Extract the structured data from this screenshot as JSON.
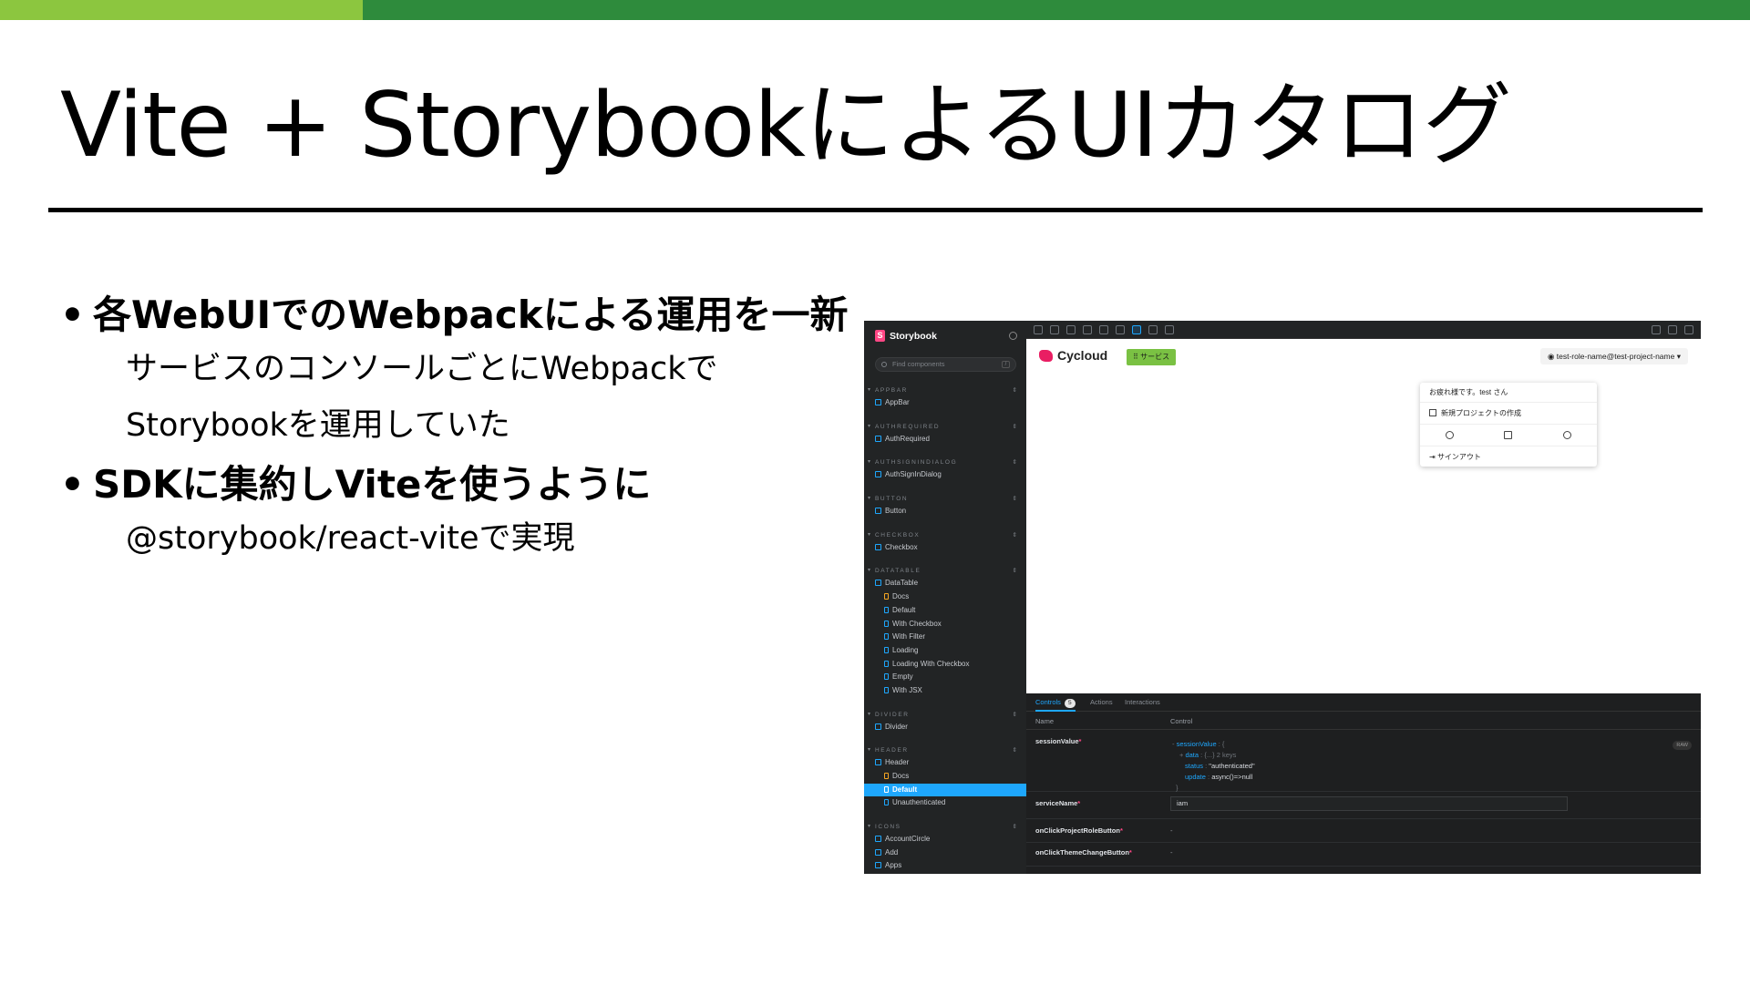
{
  "slide": {
    "title": "Vite + StorybookによるUIカタログ",
    "bullets": [
      {
        "text": "各WebUIでのWebpackによる運用を一新",
        "sub": [
          "サービスのコンソールごとにWebpackで",
          "Storybookを運用していた"
        ]
      },
      {
        "text": "SDKに集約しViteを使うように",
        "sub": [
          "@storybook/react-viteで実現"
        ]
      }
    ],
    "bullet_glyph": "•"
  },
  "colors": {
    "accent_light": "#8cc63f",
    "accent_dark": "#2e8b3c",
    "storybook_blue": "#1ea7fd",
    "storybook_pink": "#ff4785"
  },
  "storybook": {
    "brand": "Storybook",
    "search_placeholder": "Find components",
    "search_shortcut": "/",
    "groups": [
      {
        "label": "APPBAR",
        "items": [
          {
            "label": "AppBar",
            "kind": "component"
          }
        ]
      },
      {
        "label": "AUTHREQUIRED",
        "items": [
          {
            "label": "AuthRequired",
            "kind": "component"
          }
        ]
      },
      {
        "label": "AUTHSIGNINDIALOG",
        "items": [
          {
            "label": "AuthSignInDialog",
            "kind": "component"
          }
        ]
      },
      {
        "label": "BUTTON",
        "items": [
          {
            "label": "Button",
            "kind": "component"
          }
        ]
      },
      {
        "label": "CHECKBOX",
        "items": [
          {
            "label": "Checkbox",
            "kind": "component"
          }
        ]
      },
      {
        "label": "DATATABLE",
        "items": [
          {
            "label": "DataTable",
            "kind": "component"
          },
          {
            "label": "Docs",
            "kind": "doc"
          },
          {
            "label": "Default",
            "kind": "story"
          },
          {
            "label": "With Checkbox",
            "kind": "story"
          },
          {
            "label": "With Filter",
            "kind": "story"
          },
          {
            "label": "Loading",
            "kind": "story"
          },
          {
            "label": "Loading With Checkbox",
            "kind": "story"
          },
          {
            "label": "Empty",
            "kind": "story"
          },
          {
            "label": "With JSX",
            "kind": "story"
          }
        ]
      },
      {
        "label": "DIVIDER",
        "items": [
          {
            "label": "Divider",
            "kind": "component"
          }
        ]
      },
      {
        "label": "HEADER",
        "items": [
          {
            "label": "Header",
            "kind": "component"
          },
          {
            "label": "Docs",
            "kind": "doc"
          },
          {
            "label": "Default",
            "kind": "story",
            "selected": true
          },
          {
            "label": "Unauthenticated",
            "kind": "story"
          }
        ]
      },
      {
        "label": "ICONS",
        "items": [
          {
            "label": "AccountCircle",
            "kind": "component"
          },
          {
            "label": "Add",
            "kind": "component"
          },
          {
            "label": "Apps",
            "kind": "component"
          }
        ]
      }
    ],
    "canvas": {
      "logo_text": "Cycloud",
      "service_button": "サービス",
      "user_button": "test-role-name@test-project-name",
      "menu": {
        "greeting": "お疲れ様です。test さん",
        "new_project": "新規プロジェクトの作成",
        "sign_out": "サインアウト"
      }
    },
    "panel": {
      "tabs": [
        {
          "label": "Controls",
          "count": "5",
          "active": true
        },
        {
          "label": "Actions"
        },
        {
          "label": "Interactions"
        }
      ],
      "headers": {
        "name": "Name",
        "control": "Control"
      },
      "rows": [
        {
          "name": "sessionValue",
          "required": true
        },
        {
          "name": "serviceName",
          "required": true,
          "value": "iam"
        },
        {
          "name": "onClickProjectRoleButton",
          "required": true,
          "value": "-"
        },
        {
          "name": "onClickThemeChangeButton",
          "required": true,
          "value": "-"
        }
      ],
      "session_object": {
        "key": "sessionValue",
        "data_key": "data",
        "data_value": "{...} 2 keys",
        "status_key": "status",
        "status_value": "\"authenticated\"",
        "update_key": "update",
        "update_value": "async()=>null",
        "close": "}"
      },
      "raw_label": "RAW"
    }
  }
}
